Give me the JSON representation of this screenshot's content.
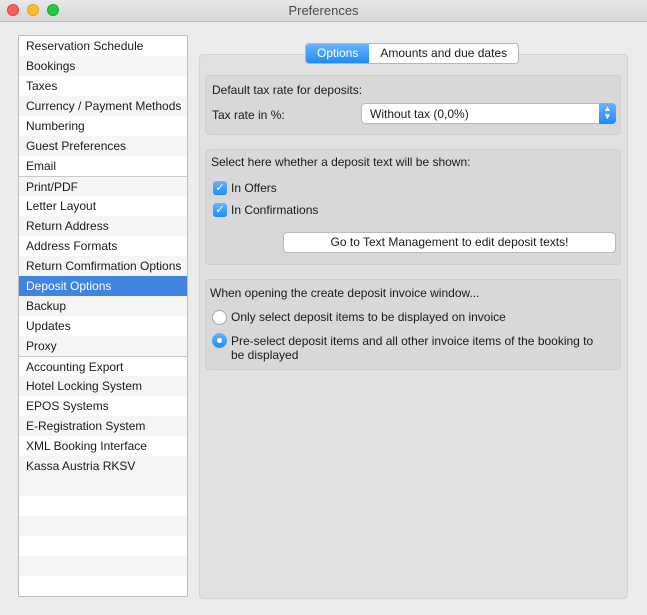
{
  "window": {
    "title": "Preferences"
  },
  "sidebar": {
    "items": [
      "Reservation Schedule",
      "Bookings",
      "Taxes",
      "Currency / Payment Methods",
      "Numbering",
      "Guest Preferences",
      "Email",
      "Print/PDF",
      "Letter Layout",
      "Return Address",
      "Address Formats",
      "Return Comfirmation Options",
      "Deposit Options",
      "Backup",
      "Updates",
      "Proxy",
      "Accounting Export",
      "Hotel Locking System",
      "EPOS Systems",
      "E-Registration System",
      "XML Booking Interface",
      "Kassa Austria RKSV"
    ],
    "selected": "Deposit Options"
  },
  "tabs": [
    {
      "label": "Options",
      "active": true
    },
    {
      "label": "Amounts and due dates",
      "active": false
    }
  ],
  "tax_group": {
    "heading": "Default tax rate for deposits:",
    "rate_label": "Tax rate in %:",
    "rate_value": "Without tax (0,0%)"
  },
  "text_group": {
    "heading": "Select here whether a deposit text will be shown:",
    "in_offers": {
      "label": "In Offers",
      "checked": true
    },
    "in_confirmations": {
      "label": "In Confirmations",
      "checked": true
    },
    "button_label": "Go to Text Management to edit deposit texts!"
  },
  "invoice_group": {
    "heading": "When opening the create deposit invoice window...",
    "option1": {
      "label": "Only select deposit items to be displayed on invoice",
      "selected": false
    },
    "option2": {
      "line1": "Pre-select deposit items and all other invoice items of the booking to",
      "line2": "be displayed",
      "selected": true
    }
  },
  "colors": {
    "accent": "#1e8cf7",
    "selection": "#3f84e0",
    "close": "#fc5f57",
    "minimize": "#fdbc2e",
    "zoom": "#28c840"
  }
}
